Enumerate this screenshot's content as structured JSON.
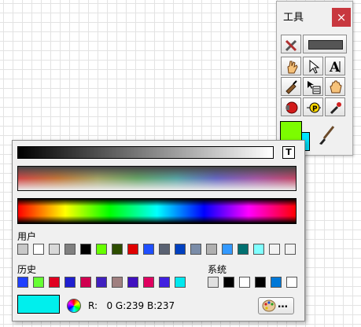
{
  "tools": {
    "title": "工具",
    "close": "×",
    "foreground_color": "#7cfc00",
    "background_color": "#00e5ff",
    "buttons": [
      {
        "name": "operate-hand-icon"
      },
      {
        "name": "position-arrow-icon"
      },
      {
        "name": "edit-text-icon"
      },
      {
        "name": "connect-wire-icon"
      },
      {
        "name": "shortcut-menu-icon"
      },
      {
        "name": "scroll-hand-icon"
      },
      {
        "name": "breakpoint-icon"
      },
      {
        "name": "probe-icon"
      },
      {
        "name": "get-color-icon"
      }
    ]
  },
  "picker": {
    "transparent_label": "T",
    "user_label": "用户",
    "history_label": "历史",
    "system_label": "系统",
    "user_colors": [
      "#c8c8c8",
      "#ffffff",
      "#d8d8d8",
      "#808080",
      "#000000",
      "#66ff00",
      "#2d4d00",
      "#e00000",
      "#1f4fff",
      "#5a6272",
      "#0040c0",
      "#7a8ca8",
      "#b0b0b0",
      "#3399ff",
      "#007070",
      "#80ffff",
      "#f2f2f2",
      "#f2f2f2"
    ],
    "history_colors": [
      "#1f3fff",
      "#66ff33",
      "#e00020",
      "#1f1fd0",
      "#d00050",
      "#4020c0",
      "#a08080",
      "#4010c0",
      "#e00060",
      "#4020e0",
      "#00e8ef"
    ],
    "system_colors": [
      "#e0e0e0",
      "#000000",
      "#ffffff",
      "#000000",
      "#0078d7",
      "#ffffff"
    ],
    "current_color": "#00efed",
    "rgb_text": "R:   0 G:239 B:237",
    "more_label": "…"
  }
}
